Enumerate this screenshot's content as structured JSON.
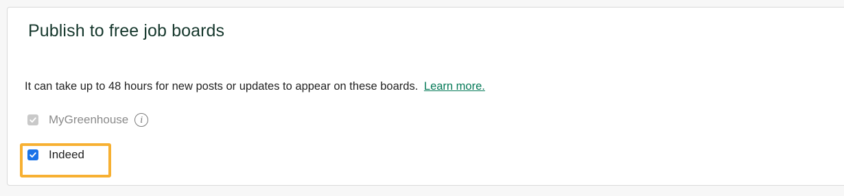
{
  "card": {
    "title": "Publish to free job boards",
    "info_text": "It can take up to 48 hours for new posts or updates to appear on these boards.",
    "learn_more_label": "Learn more."
  },
  "boards": [
    {
      "label": "MyGreenhouse",
      "checked": true,
      "disabled": true,
      "icon": "info-icon",
      "icon_glyph": "i"
    },
    {
      "label": "Indeed",
      "checked": true,
      "disabled": false,
      "highlighted": true
    }
  ],
  "colors": {
    "title": "#15372c",
    "link": "#047957",
    "checkbox_checked": "#1a73e8",
    "checkbox_disabled": "#c9c9c9",
    "highlight": "#f7b032"
  }
}
